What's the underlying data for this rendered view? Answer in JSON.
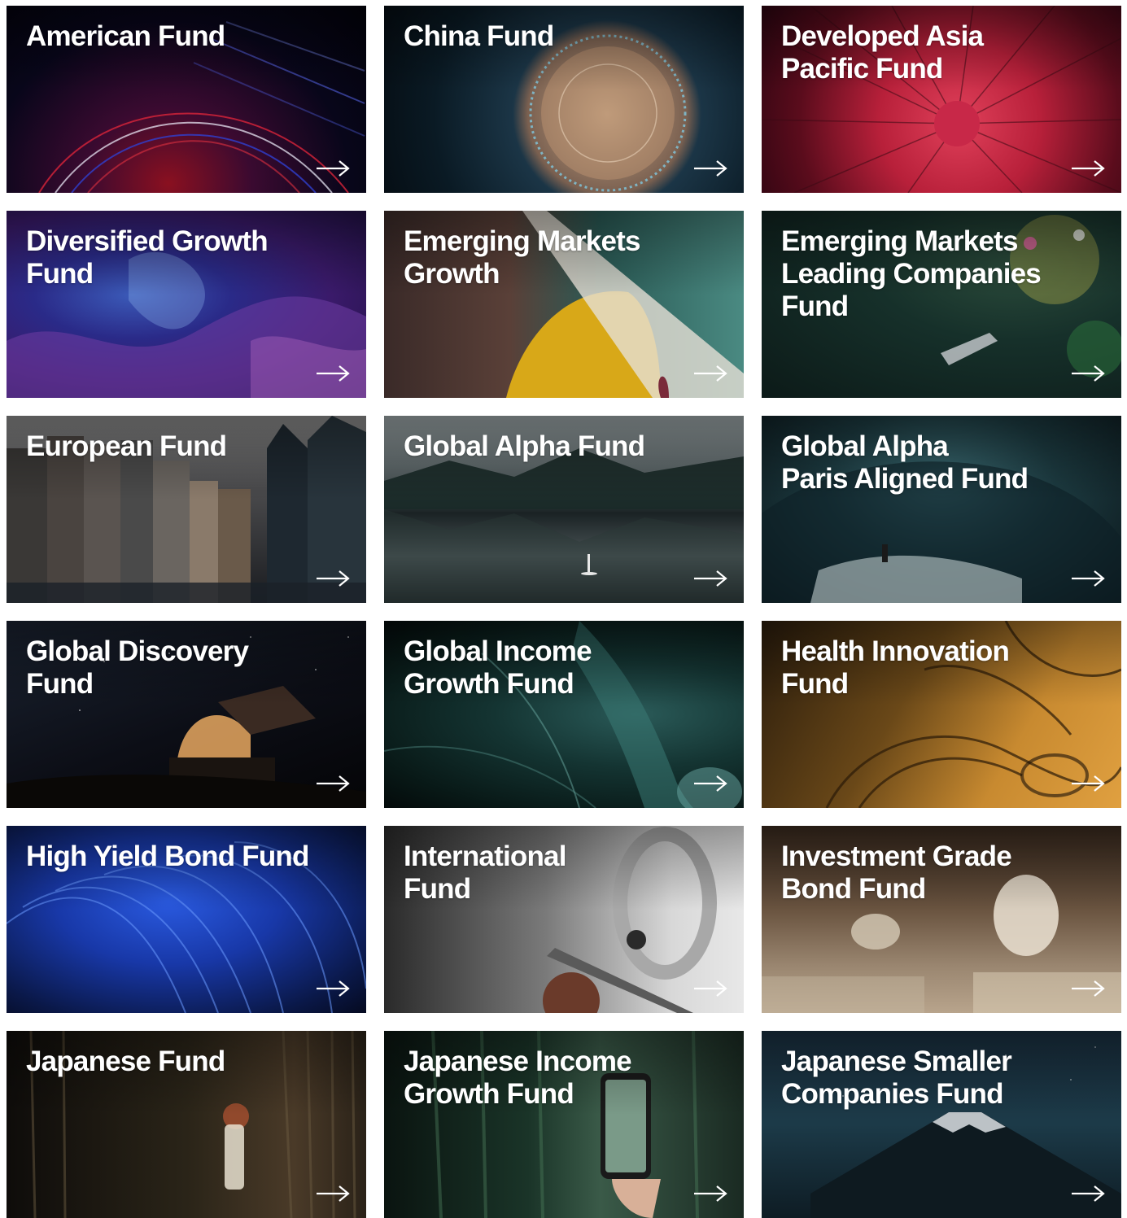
{
  "funds": [
    {
      "title": "American Fund",
      "arrow_icon": "arrow-right-icon"
    },
    {
      "title": "China Fund",
      "arrow_icon": "arrow-right-icon"
    },
    {
      "title": "Developed Asia\nPacific Fund",
      "arrow_icon": "arrow-right-icon"
    },
    {
      "title": "Diversified Growth\nFund",
      "arrow_icon": "arrow-right-icon"
    },
    {
      "title": "Emerging Markets\nGrowth",
      "arrow_icon": "arrow-right-icon"
    },
    {
      "title": "Emerging Markets\nLeading Companies\nFund",
      "arrow_icon": "arrow-right-icon"
    },
    {
      "title": "European Fund",
      "arrow_icon": "arrow-right-icon"
    },
    {
      "title": "Global Alpha Fund",
      "arrow_icon": "arrow-right-icon"
    },
    {
      "title": "Global Alpha\nParis Aligned Fund",
      "arrow_icon": "arrow-right-icon"
    },
    {
      "title": "Global Discovery\nFund",
      "arrow_icon": "arrow-right-icon"
    },
    {
      "title": "Global Income\nGrowth Fund",
      "arrow_icon": "arrow-right-icon"
    },
    {
      "title": "Health Innovation\nFund",
      "arrow_icon": "arrow-right-icon"
    },
    {
      "title": "High Yield Bond Fund",
      "arrow_icon": "arrow-right-icon"
    },
    {
      "title": "International\nFund",
      "arrow_icon": "arrow-right-icon"
    },
    {
      "title": "Investment Grade\nBond Fund",
      "arrow_icon": "arrow-right-icon"
    },
    {
      "title": "Japanese Fund",
      "arrow_icon": "arrow-right-icon"
    },
    {
      "title": "Japanese Income\nGrowth Fund",
      "arrow_icon": "arrow-right-icon"
    },
    {
      "title": "Japanese Smaller\nCompanies Fund",
      "arrow_icon": "arrow-right-icon"
    }
  ]
}
